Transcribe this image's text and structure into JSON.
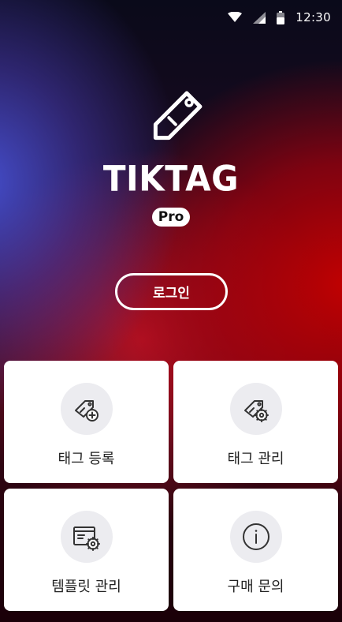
{
  "status_bar": {
    "time": "12:30",
    "icons": [
      "wifi-icon",
      "cell-signal-icon",
      "battery-icon"
    ]
  },
  "brand": {
    "logo_icon": "tag-icon",
    "name": "TIKTAG",
    "badge": "Pro"
  },
  "login": {
    "label": "로그인"
  },
  "menu": [
    {
      "label": "태그 등록",
      "icon": "tag-plus-icon"
    },
    {
      "label": "태그 관리",
      "icon": "tag-gear-icon"
    },
    {
      "label": "템플릿 관리",
      "icon": "template-gear-icon"
    },
    {
      "label": "구매 문의",
      "icon": "info-icon"
    }
  ],
  "colors": {
    "gradient_blue": "#4650d2",
    "gradient_red": "#c80000",
    "card_bg": "#ffffff",
    "icon_circle": "#ececf0",
    "icon_stroke": "#333333"
  }
}
